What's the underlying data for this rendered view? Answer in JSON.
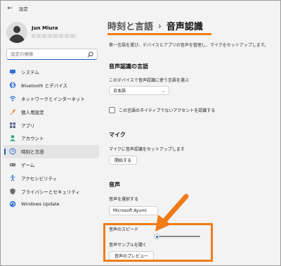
{
  "window": {
    "title": "設定",
    "back_icon": "back-arrow-icon"
  },
  "user": {
    "name": "Jun Miura"
  },
  "search": {
    "placeholder": "設定の検索"
  },
  "sidebar": {
    "items": [
      {
        "label": "システム",
        "icon": "monitor-icon",
        "color": "#2f6fd6"
      },
      {
        "label": "Bluetooth とデバイス",
        "icon": "bluetooth-icon",
        "color": "#2f6fd6"
      },
      {
        "label": "ネットワークとインターネット",
        "icon": "wifi-icon",
        "color": "#2f6fd6"
      },
      {
        "label": "個人用設定",
        "icon": "brush-icon",
        "color": "#e08c3c"
      },
      {
        "label": "アプリ",
        "icon": "apps-icon",
        "color": "#5b6b86"
      },
      {
        "label": "アカウント",
        "icon": "account-icon",
        "color": "#2fa37a"
      },
      {
        "label": "時刻と言語",
        "icon": "clock-globe-icon",
        "color": "#2f6fd6",
        "active": true
      },
      {
        "label": "ゲーム",
        "icon": "gamepad-icon",
        "color": "#6b6b6b"
      },
      {
        "label": "アクセシビリティ",
        "icon": "accessibility-icon",
        "color": "#2f6fd6"
      },
      {
        "label": "プライバシーとセキュリティ",
        "icon": "shield-icon",
        "color": "#6b6b6b"
      },
      {
        "label": "Windows Update",
        "icon": "update-icon",
        "color": "#2f6fd6"
      }
    ]
  },
  "main": {
    "breadcrumb_parent": "時刻と言語",
    "breadcrumb_current": "音声認識",
    "description": "第一言語を選び、デバイスとアプリの音声を管理し、マイクをセットアップします。",
    "language_section": {
      "title": "音声認識の言語",
      "select_label": "このデバイスで音声認識に使う言語を選ぶ",
      "select_value": "日本語",
      "checkbox_label": "この言語のネイティブでないアクセントを認識する",
      "checkbox_checked": false
    },
    "mic_section": {
      "title": "マイク",
      "setup_label": "マイクに音声認識をセットアップします",
      "start_button": "開始する"
    },
    "voice_section": {
      "title": "音声",
      "voice_select_label": "音声を選択する",
      "voice_value": "Microsoft Ayumi",
      "speed_label": "音声のスピード",
      "speed_level": 0.0,
      "sample_label": "音声サンプルを聞く",
      "preview_button": "音声のプレビュー"
    }
  },
  "colors": {
    "accent": "#1b5fb8",
    "highlight": "#f07b17"
  }
}
